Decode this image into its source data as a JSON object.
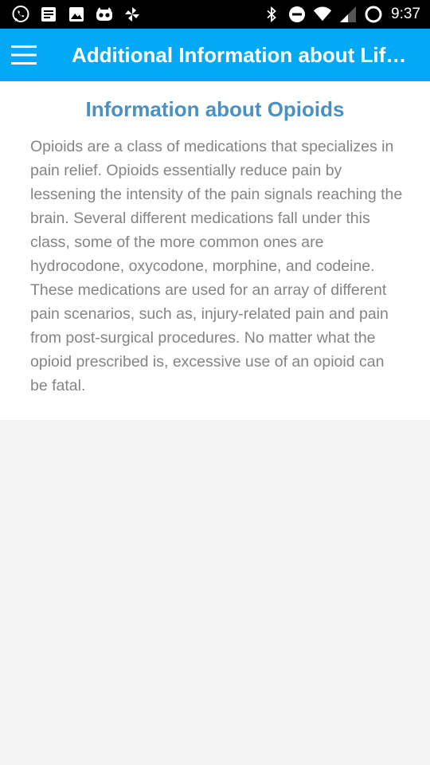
{
  "status_bar": {
    "left_icons": [
      "whatsapp-icon",
      "notes-icon",
      "gallery-icon",
      "cyanogen-icon",
      "pinwheel-icon"
    ],
    "right_icons": [
      "bluetooth-icon",
      "do-not-disturb-icon",
      "wifi-icon",
      "signal-icon",
      "battery-icon"
    ],
    "time": "9:37"
  },
  "app_bar": {
    "title": "Additional Information about Lif…",
    "menu_icon": "hamburger-menu-icon",
    "background_color": "#03a9f4"
  },
  "content": {
    "heading": "Information about Opioids",
    "heading_color": "#4a90c2",
    "body": "Opioids are a class of medications that specializes in pain relief. Opioids essentially reduce pain by lessening the intensity of the pain signals reaching the brain. Several different medications fall under this class, some of the more common ones are hydrocodone, oxycodone, morphine, and codeine. These medications are used for an array of different pain scenarios, such as, injury-related pain and pain from post-surgical procedures. No matter what the opioid prescribed is, excessive use of an opioid can be fatal."
  }
}
